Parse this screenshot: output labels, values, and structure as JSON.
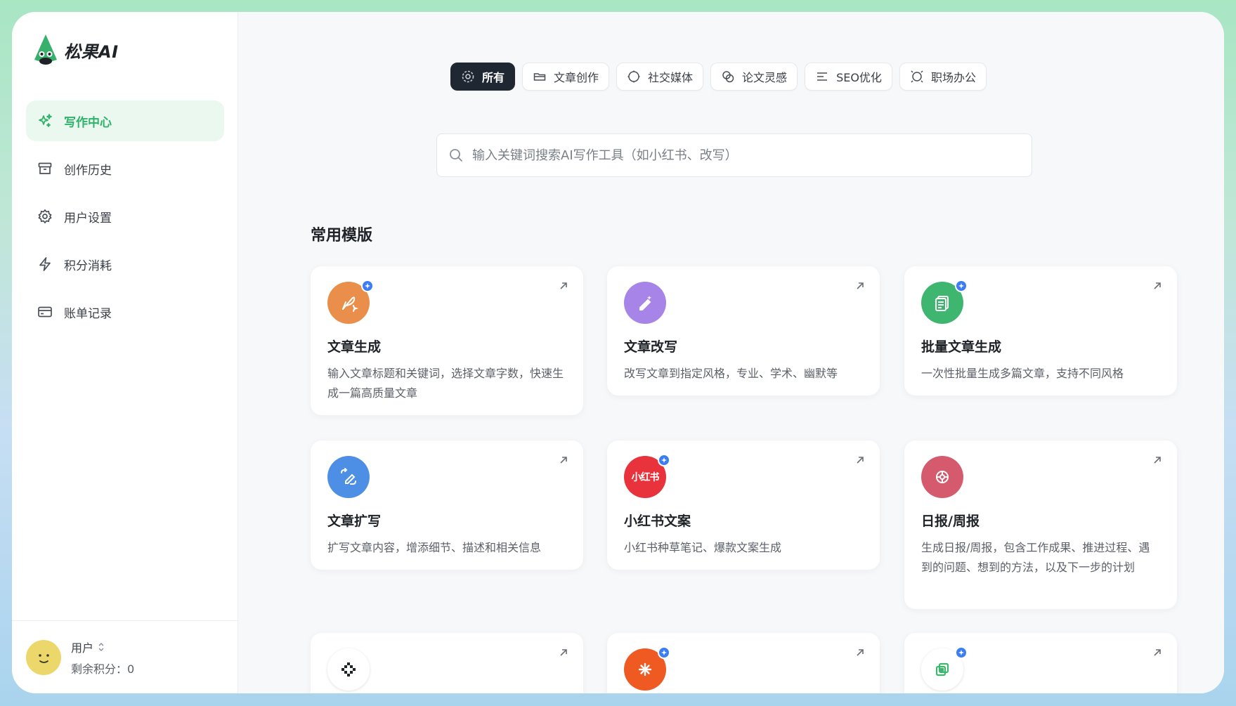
{
  "app": {
    "name": "松果AI"
  },
  "sidebar": {
    "items": [
      {
        "label": "写作中心",
        "icon": "sparkles-icon",
        "active": true
      },
      {
        "label": "创作历史",
        "icon": "archive-icon",
        "active": false
      },
      {
        "label": "用户设置",
        "icon": "gear-icon",
        "active": false
      },
      {
        "label": "积分消耗",
        "icon": "lightning-icon",
        "active": false
      },
      {
        "label": "账单记录",
        "icon": "card-icon",
        "active": false
      }
    ],
    "user": {
      "name": "用户",
      "points_label": "剩余积分：",
      "points": "0"
    }
  },
  "tabs": [
    {
      "label": "所有",
      "icon": "target-icon",
      "active": true
    },
    {
      "label": "文章创作",
      "icon": "folder-icon",
      "active": false
    },
    {
      "label": "社交媒体",
      "icon": "circle-icon",
      "active": false
    },
    {
      "label": "论文灵感",
      "icon": "overlap-icon",
      "active": false
    },
    {
      "label": "SEO优化",
      "icon": "lines-icon",
      "active": false
    },
    {
      "label": "职场办公",
      "icon": "ring-icon",
      "active": false
    }
  ],
  "search": {
    "placeholder": "输入关键词搜索AI写作工具（如小红书、改写）"
  },
  "section": {
    "title": "常用模版"
  },
  "cards": [
    {
      "title": "文章生成",
      "desc": "输入文章标题和关键词，选择文章字数，快速生成一篇高质量文章",
      "icon": "feather-icon",
      "color": "#e98f4b",
      "badge": true
    },
    {
      "title": "文章改写",
      "desc": "改写文章到指定风格，专业、学术、幽默等",
      "icon": "magic-pen-icon",
      "color": "#a684e8",
      "badge": false
    },
    {
      "title": "批量文章生成",
      "desc": "一次性批量生成多篇文章，支持不同风格",
      "icon": "documents-icon",
      "color": "#3eb66f",
      "badge": true
    },
    {
      "title": "文章扩写",
      "desc": "扩写文章内容，增添细节、描述和相关信息",
      "icon": "expand-pen-icon",
      "color": "#4e8fe6",
      "badge": false
    },
    {
      "title": "小红书文案",
      "desc": "小红书种草笔记、爆款文案生成",
      "icon": "xiaohongshu-icon",
      "color": "#e8323c",
      "badge": true,
      "icon_text": "小红书"
    },
    {
      "title": "日报/周报",
      "desc": "生成日报/周报，包含工作成果、推进过程、遇到的问题、想到的方法，以及下一步的计划",
      "icon": "flower-icon",
      "color": "#d65a6e",
      "badge": false
    },
    {
      "title": "",
      "desc": "",
      "icon": "diamond-dots-icon",
      "color": "#ffffff",
      "badge": false
    },
    {
      "title": "",
      "desc": "",
      "icon": "asterisk-icon",
      "color": "#ef5a22",
      "badge": true
    },
    {
      "title": "",
      "desc": "",
      "icon": "copy-square-icon",
      "color": "#ffffff",
      "badge": true
    }
  ]
}
